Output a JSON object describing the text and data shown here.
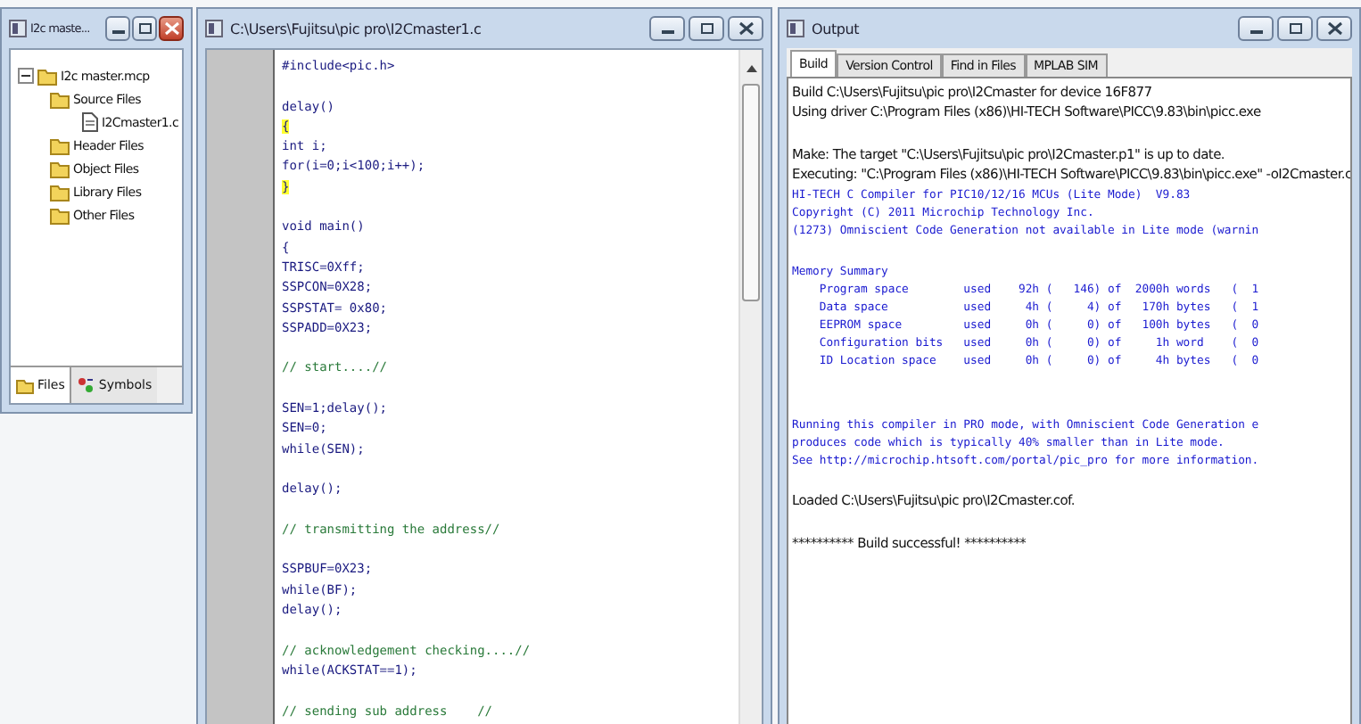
{
  "project_window": {
    "title": "I2c maste...",
    "tree": [
      {
        "label": "I2c master.mcp",
        "kind": "project",
        "expanded": true,
        "children": [
          {
            "label": "Source Files",
            "kind": "folder",
            "children": [
              {
                "label": "I2Cmaster1.c",
                "kind": "file"
              }
            ]
          },
          {
            "label": "Header Files",
            "kind": "folder"
          },
          {
            "label": "Object Files",
            "kind": "folder"
          },
          {
            "label": "Library Files",
            "kind": "folder"
          },
          {
            "label": "Other Files",
            "kind": "folder"
          }
        ]
      }
    ],
    "tabs": [
      {
        "label": "Files",
        "selected": true
      },
      {
        "label": "Symbols",
        "selected": false
      }
    ]
  },
  "editor_window": {
    "title": "C:\\Users\\Fujitsu\\pic pro\\I2Cmaster1.c",
    "lines": [
      {
        "kind": "code",
        "text": "#include<pic.h>",
        "highlight": false
      },
      {
        "kind": "blank"
      },
      {
        "kind": "code",
        "text": "delay()",
        "highlight": false
      },
      {
        "kind": "code",
        "text": "{",
        "highlight": true
      },
      {
        "kind": "code",
        "text": "int i;",
        "highlight": false
      },
      {
        "kind": "code",
        "text": "for(i=0;i<100;i++);",
        "highlight": false
      },
      {
        "kind": "code",
        "text": "}",
        "highlight": true
      },
      {
        "kind": "blank"
      },
      {
        "kind": "code",
        "text": "void main()",
        "highlight": false
      },
      {
        "kind": "code",
        "text": "{",
        "highlight": false
      },
      {
        "kind": "code",
        "text": "TRISC=0Xff;",
        "highlight": false
      },
      {
        "kind": "code",
        "text": "SSPCON=0X28;",
        "highlight": false
      },
      {
        "kind": "code",
        "text": "SSPSTAT= 0x80;",
        "highlight": false
      },
      {
        "kind": "code",
        "text": "SSPADD=0X23;",
        "highlight": false
      },
      {
        "kind": "blank"
      },
      {
        "kind": "comment",
        "text": "// start....//"
      },
      {
        "kind": "blank"
      },
      {
        "kind": "code",
        "text": "SEN=1;delay();",
        "highlight": false
      },
      {
        "kind": "code",
        "text": "SEN=0;",
        "highlight": false
      },
      {
        "kind": "code",
        "text": "while(SEN);",
        "highlight": false
      },
      {
        "kind": "blank"
      },
      {
        "kind": "code",
        "text": "delay();",
        "highlight": false
      },
      {
        "kind": "blank"
      },
      {
        "kind": "comment",
        "text": "// transmitting the address//"
      },
      {
        "kind": "blank"
      },
      {
        "kind": "code",
        "text": "SSPBUF=0X23;",
        "highlight": false
      },
      {
        "kind": "code",
        "text": "while(BF);",
        "highlight": false
      },
      {
        "kind": "code",
        "text": "delay();",
        "highlight": false
      },
      {
        "kind": "blank"
      },
      {
        "kind": "comment",
        "text": "// acknowledgement checking....//"
      },
      {
        "kind": "code",
        "text": "while(ACKSTAT==1);",
        "highlight": false
      },
      {
        "kind": "blank"
      },
      {
        "kind": "comment",
        "text": "// sending sub address    //"
      }
    ]
  },
  "output_window": {
    "title": "Output",
    "tabs": [
      {
        "label": "Build",
        "selected": true
      },
      {
        "label": "Version Control",
        "selected": false
      },
      {
        "label": "Find in Files",
        "selected": false
      },
      {
        "label": "MPLAB SIM",
        "selected": false
      }
    ],
    "lines": [
      {
        "kind": "info",
        "text": "Build C:\\Users\\Fujitsu\\pic pro\\I2Cmaster for device 16F877"
      },
      {
        "kind": "info",
        "text": "Using driver C:\\Program Files (x86)\\HI-TECH Software\\PICC\\9.83\\bin\\picc.exe"
      },
      {
        "kind": "blank"
      },
      {
        "kind": "info",
        "text": "Make: The target \"C:\\Users\\Fujitsu\\pic pro\\I2Cmaster.p1\" is up to date."
      },
      {
        "kind": "info",
        "text": "Executing: \"C:\\Program Files (x86)\\HI-TECH Software\\PICC\\9.83\\bin\\picc.exe\" -oI2Cmaster.c"
      },
      {
        "kind": "compiler",
        "text": "HI-TECH C Compiler for PIC10/12/16 MCUs (Lite Mode)  V9.83"
      },
      {
        "kind": "compiler",
        "text": "Copyright (C) 2011 Microchip Technology Inc."
      },
      {
        "kind": "compiler",
        "text": "(1273) Omniscient Code Generation not available in Lite mode (warnin"
      },
      {
        "kind": "blank"
      },
      {
        "kind": "compiler",
        "text": "Memory Summary"
      },
      {
        "kind": "compiler",
        "text": "    Program space        used    92h (   146) of  2000h words   (  1"
      },
      {
        "kind": "compiler",
        "text": "    Data space           used     4h (     4) of   170h bytes   (  1"
      },
      {
        "kind": "compiler",
        "text": "    EEPROM space         used     0h (     0) of   100h bytes   (  0"
      },
      {
        "kind": "compiler",
        "text": "    Configuration bits   used     0h (     0) of     1h word    (  0"
      },
      {
        "kind": "compiler",
        "text": "    ID Location space    used     0h (     0) of     4h bytes   (  0"
      },
      {
        "kind": "blank"
      },
      {
        "kind": "blank"
      },
      {
        "kind": "compiler",
        "text": "Running this compiler in PRO mode, with Omniscient Code Generation e"
      },
      {
        "kind": "compiler",
        "text": "produces code which is typically 40% smaller than in Lite mode."
      },
      {
        "kind": "compiler",
        "text": "See http://microchip.htsoft.com/portal/pic_pro for more information."
      },
      {
        "kind": "blank"
      },
      {
        "kind": "info",
        "text": "Loaded C:\\Users\\Fujitsu\\pic pro\\I2Cmaster.cof."
      },
      {
        "kind": "blank"
      },
      {
        "kind": "info",
        "text": "********** Build successful! **********"
      }
    ]
  }
}
